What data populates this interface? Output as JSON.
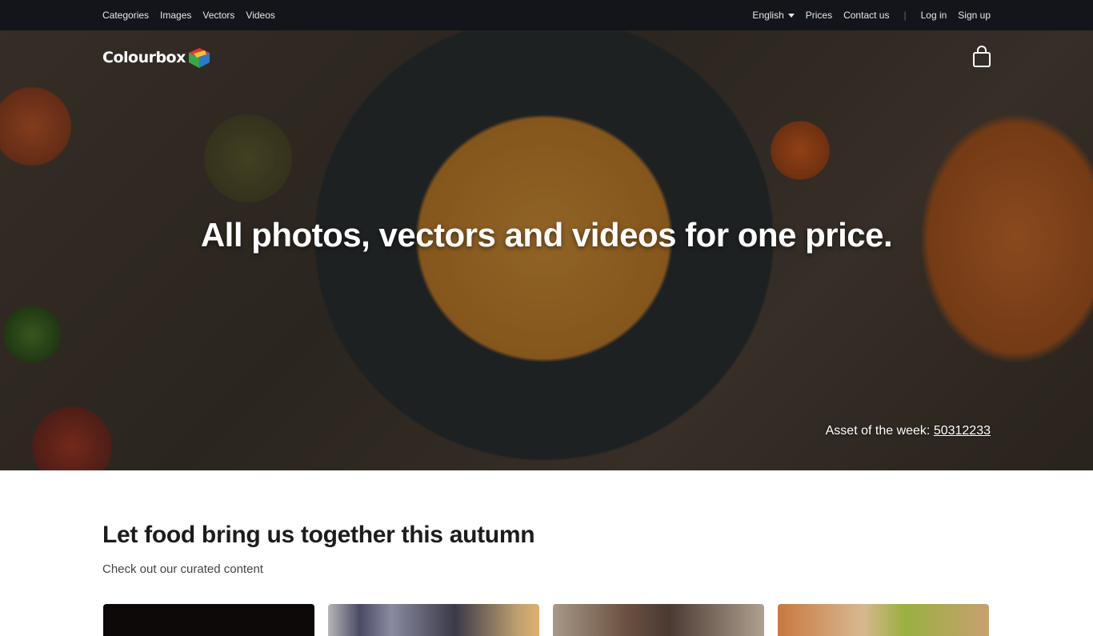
{
  "topbar": {
    "left_links": [
      "Categories",
      "Images",
      "Vectors",
      "Videos"
    ],
    "language": "English",
    "prices": "Prices",
    "contact": "Contact us",
    "separator": "|",
    "login": "Log in",
    "signup": "Sign up"
  },
  "brand": {
    "name": "Colourbox"
  },
  "hero": {
    "headline": "All photos, vectors and videos for one price.",
    "asset_label": "Asset of the week:",
    "asset_id": "50312233"
  },
  "section": {
    "title": "Let food bring us together this autumn",
    "subtitle": "Check out our curated content"
  },
  "cards": [
    {
      "name": "curated-card-1"
    },
    {
      "name": "curated-card-2"
    },
    {
      "name": "curated-card-3"
    },
    {
      "name": "curated-card-4"
    }
  ],
  "colors": {
    "topbar_bg": "#13151a",
    "heading": "#1c1c1f"
  }
}
